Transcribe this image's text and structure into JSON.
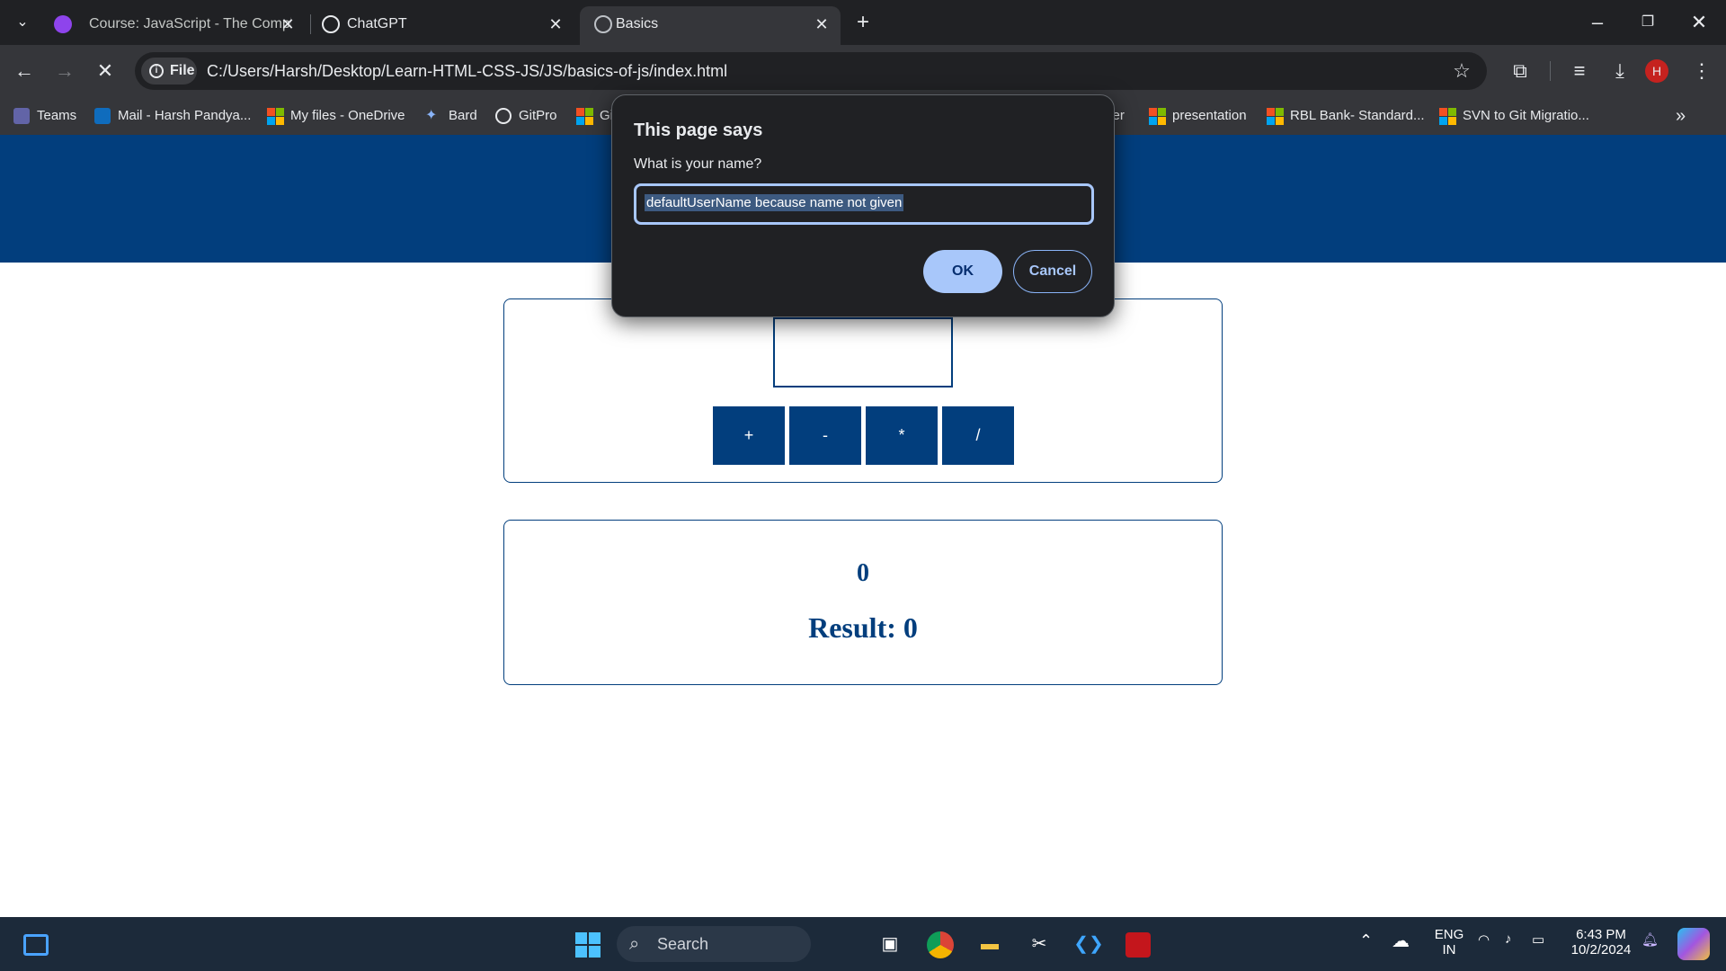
{
  "tabs": [
    {
      "title": "Course: JavaScript - The Compl",
      "active": false
    },
    {
      "title": "ChatGPT",
      "active": false
    },
    {
      "title": "Basics",
      "active": true
    }
  ],
  "toolbar": {
    "file_chip": "File",
    "url": "C:/Users/Harsh/Desktop/Learn-HTML-CSS-JS/JS/basics-of-js/index.html",
    "profile_initial": "H"
  },
  "bookmarks": [
    {
      "label": "Teams"
    },
    {
      "label": "Mail - Harsh Pandya..."
    },
    {
      "label": "My files - OneDrive"
    },
    {
      "label": "Bard"
    },
    {
      "label": "GitPro"
    },
    {
      "label": "Gi"
    },
    {
      "label": "ver"
    },
    {
      "label": "presentation"
    },
    {
      "label": "RBL Bank- Standard..."
    },
    {
      "label": "SVN to Git Migratio..."
    }
  ],
  "dialog": {
    "title": "This page says",
    "message": "What is your name?",
    "input_value": "defaultUserName because name not given",
    "ok_label": "OK",
    "cancel_label": "Cancel"
  },
  "calculator": {
    "operators": [
      "+",
      "-",
      "*",
      "/"
    ],
    "current_value": "0",
    "result_text": "Result: 0"
  },
  "taskbar": {
    "search_label": "Search",
    "language_line1": "ENG",
    "language_line2": "IN",
    "time": "6:43 PM",
    "date": "10/2/2024"
  },
  "colors": {
    "brand": "#023e7d",
    "dialog_bg": "#202124",
    "accent": "#a8c7fa"
  }
}
